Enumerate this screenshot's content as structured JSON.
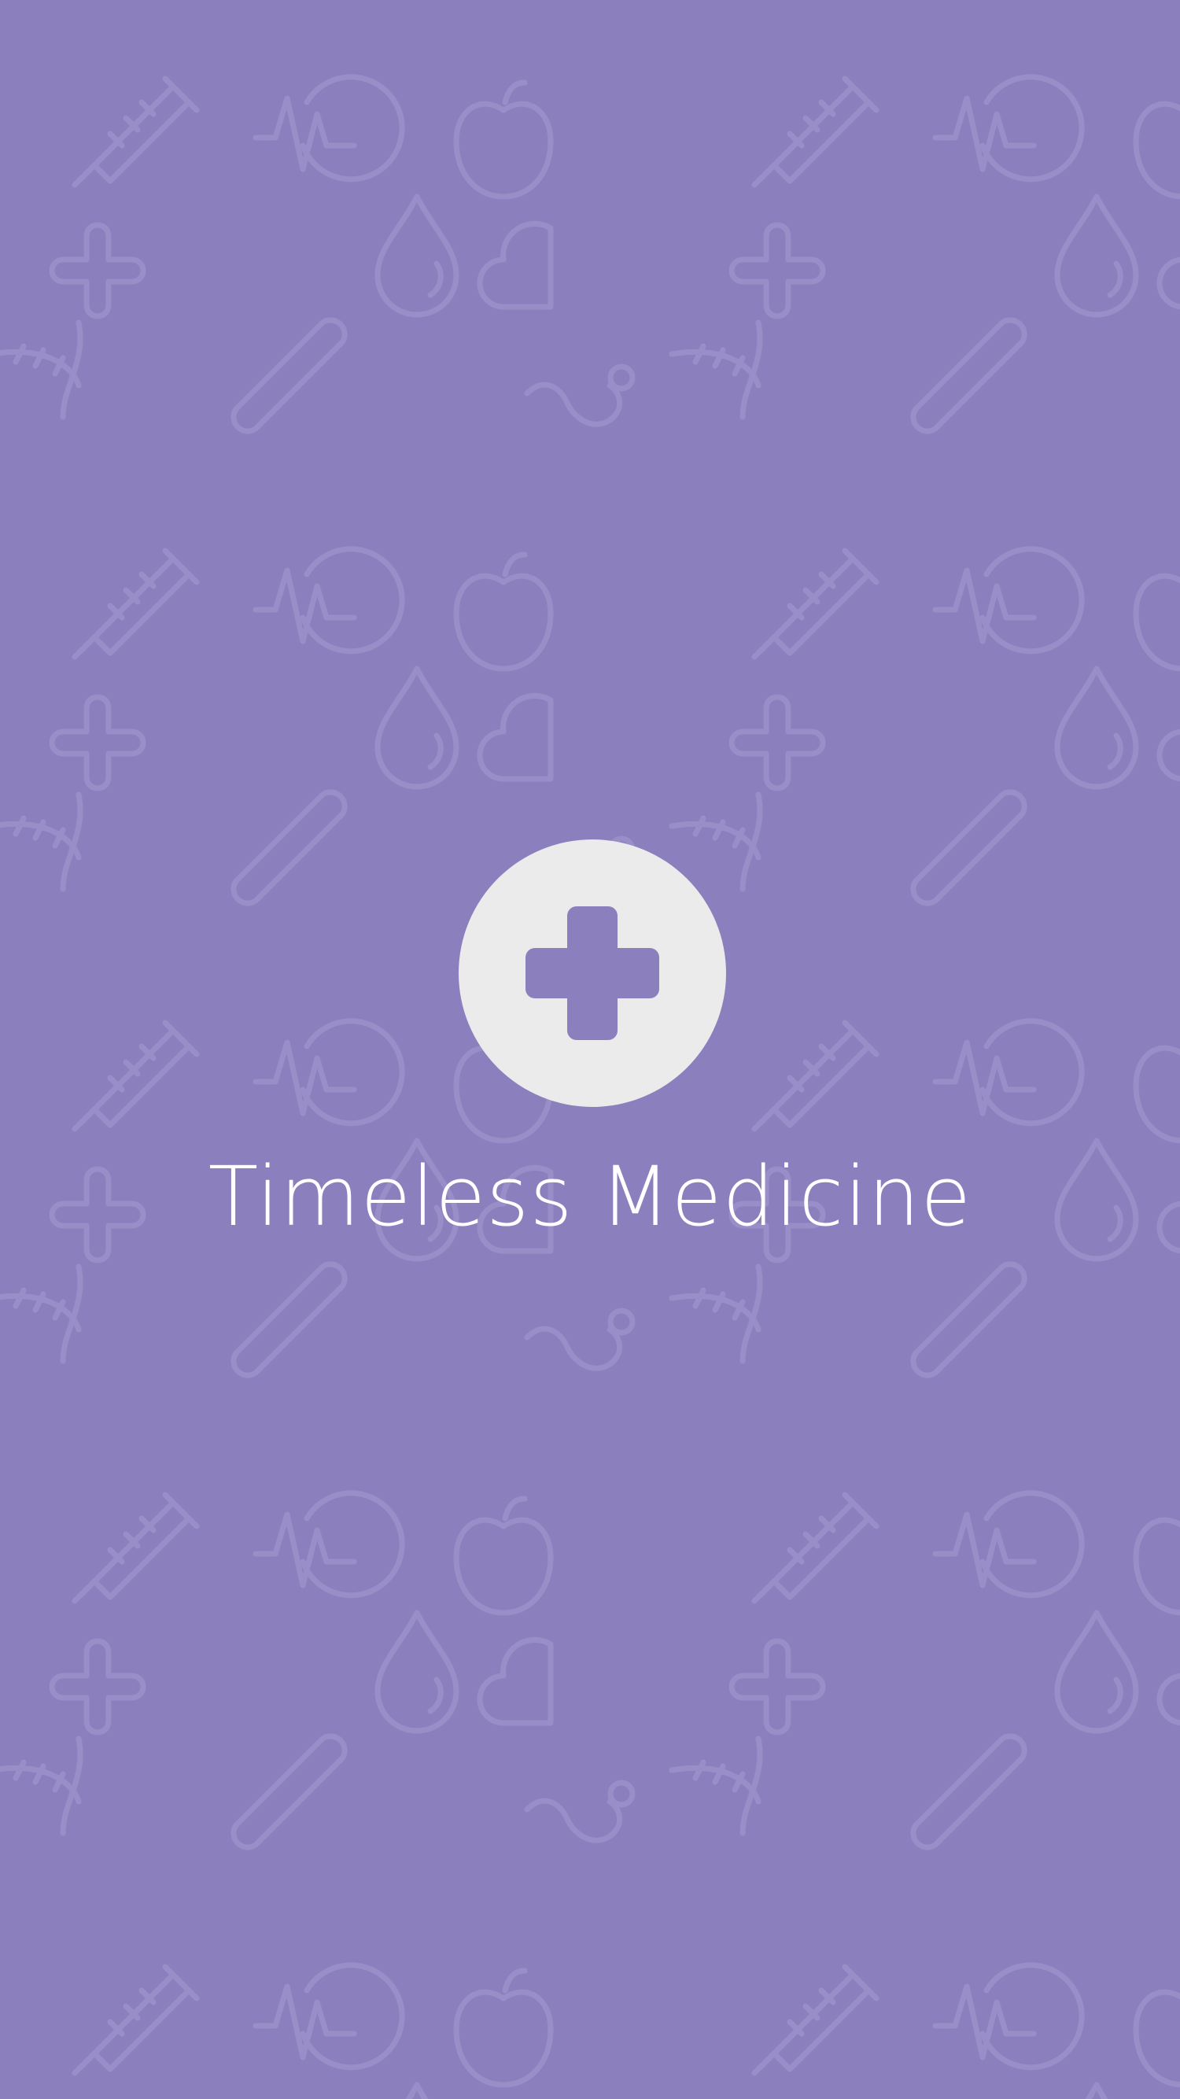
{
  "app": {
    "title": "Timeless Medicine",
    "logo_icon": "medical-cross-icon",
    "background_pattern_icons": [
      "plus-icon",
      "drop-icon",
      "heart-icon",
      "apple-icon",
      "syringe-icon",
      "dna-icon",
      "stethoscope-icon",
      "test-tube-icon",
      "heartbeat-icon"
    ]
  },
  "colors": {
    "background": "#8c7fbd",
    "logo_circle": "#ebebeb",
    "title_text": "#ffffff"
  }
}
